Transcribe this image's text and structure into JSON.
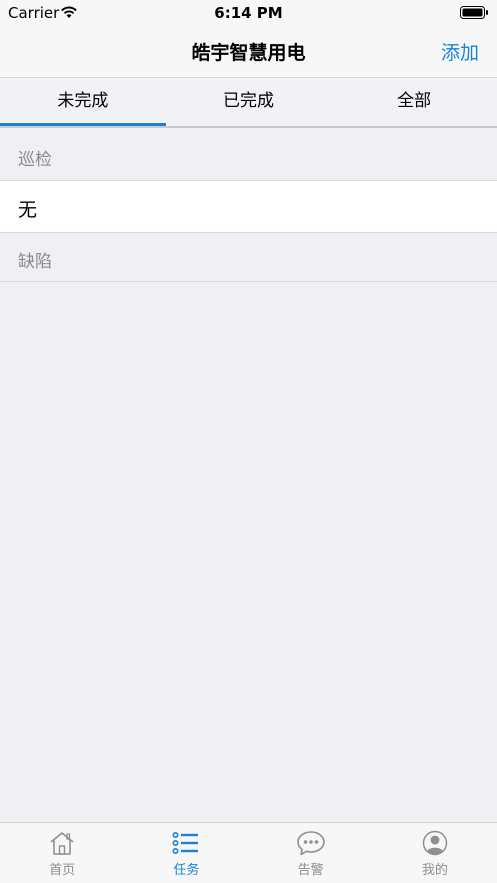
{
  "status_bar": {
    "carrier": "Carrier",
    "time": "6:14 PM"
  },
  "nav": {
    "title": "皓宇智慧用电",
    "add_label": "添加"
  },
  "segments": [
    {
      "label": "未完成",
      "active": true
    },
    {
      "label": "已完成",
      "active": false
    },
    {
      "label": "全部",
      "active": false
    }
  ],
  "sections": {
    "inspection_header": "巡检",
    "inspection_row": "无",
    "defect_header": "缺陷"
  },
  "tab_bar": [
    {
      "label": "首页",
      "icon": "home-icon",
      "active": false
    },
    {
      "label": "任务",
      "icon": "list-icon",
      "active": true
    },
    {
      "label": "告警",
      "icon": "chat-bubble-icon",
      "active": false
    },
    {
      "label": "我的",
      "icon": "user-icon",
      "active": false
    }
  ],
  "colors": {
    "accent": "#1a82d6",
    "inactive": "#8e8e93",
    "background": "#efeff4"
  }
}
